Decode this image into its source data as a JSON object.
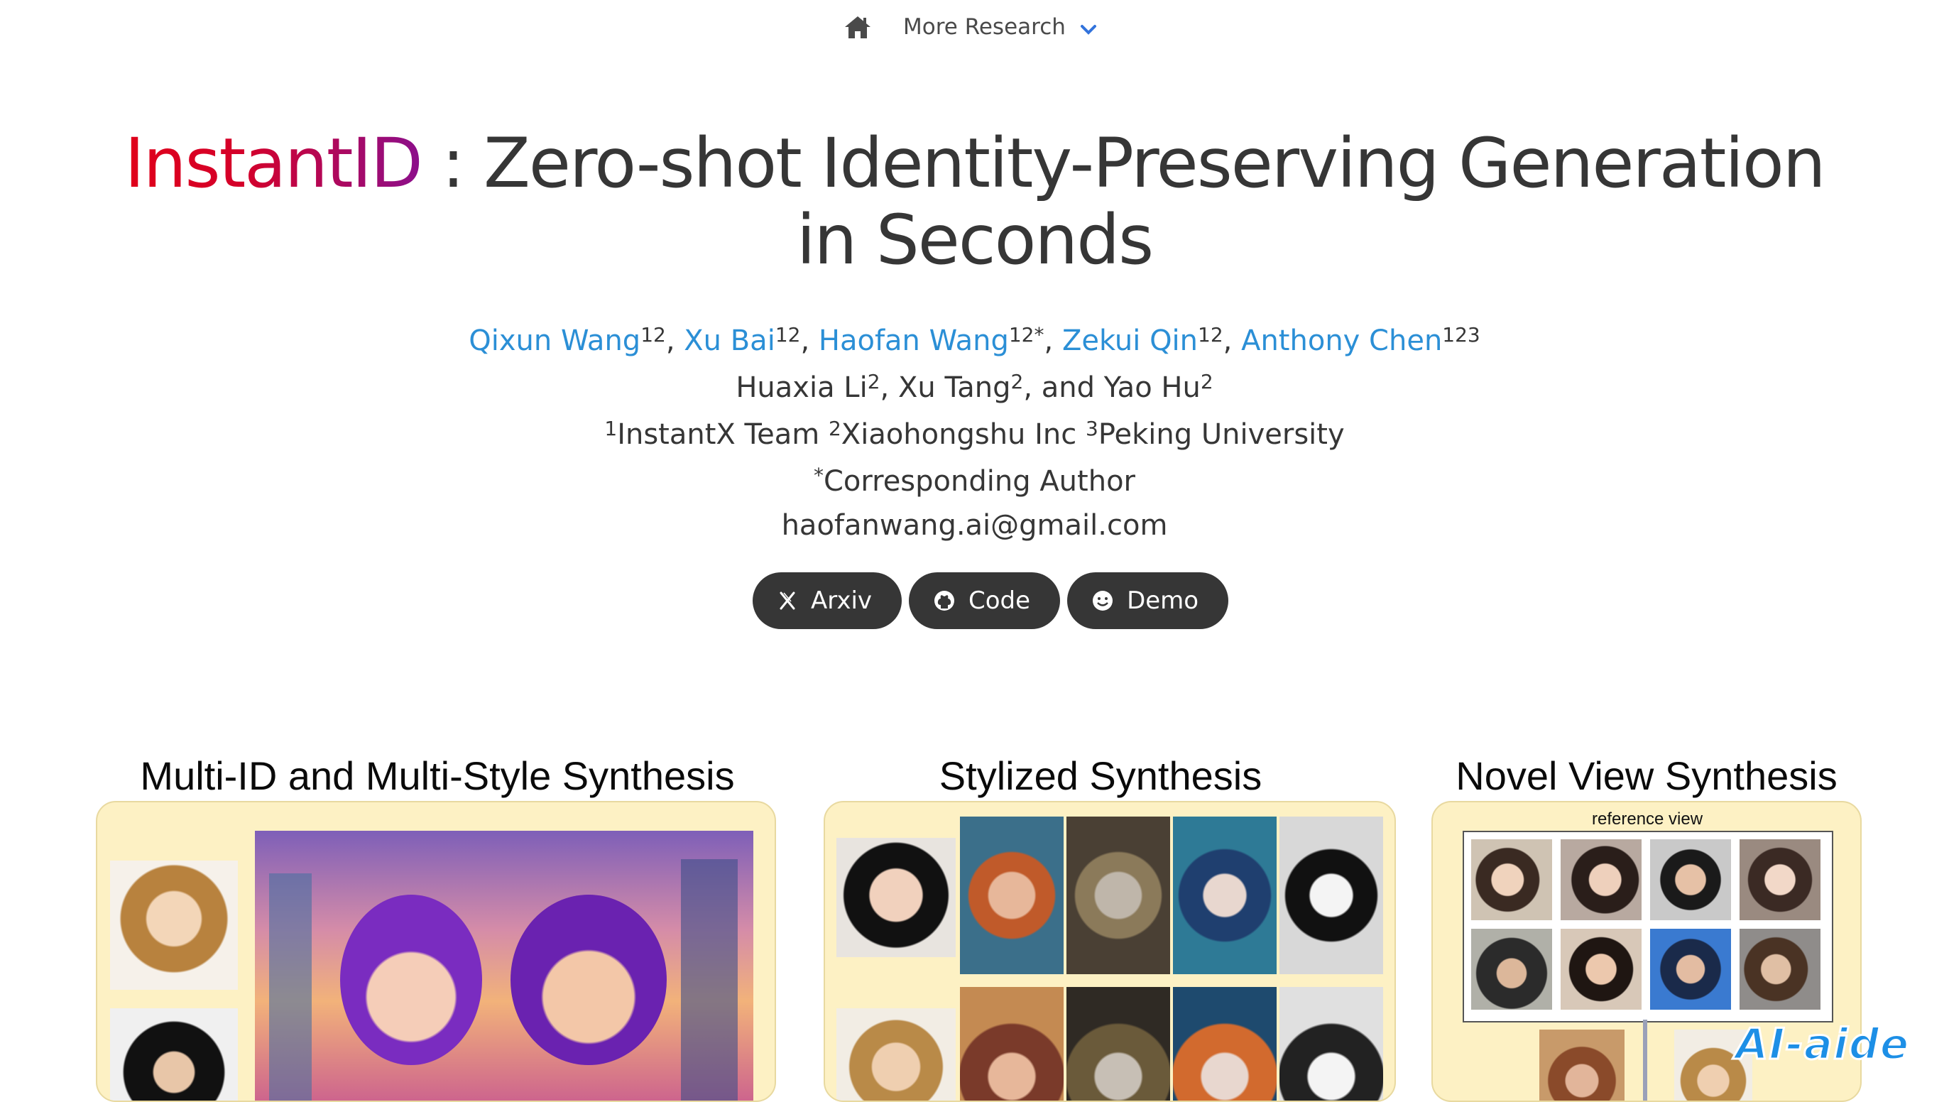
{
  "nav": {
    "home_icon": "home-icon",
    "more_label": "More Research",
    "chevron_icon": "chevron-down-icon"
  },
  "title": {
    "brand": "InstantID",
    "line1_rest": " : Zero-shot Identity-Preserving Generation",
    "line2": "in Seconds"
  },
  "authors": {
    "a1": "Qixun Wang",
    "a1_sup": "12",
    "a2": "Xu Bai",
    "a2_sup": "12",
    "a3": "Haofan Wang",
    "a3_sup": "12*",
    "a4": "Zekui Qin",
    "a4_sup": "12",
    "a5": "Anthony Chen",
    "a5_sup": "123",
    "b1": "Huaxia Li",
    "b1_sup": "2",
    "b2": "Xu Tang",
    "b2_sup": "2",
    "b3": "Yao Hu",
    "b3_sup": "2",
    "aff1_sup": "1",
    "aff1": "InstantX Team",
    "aff2_sup": "2",
    "aff2": "Xiaohongshu Inc",
    "aff3_sup": "3",
    "aff3": "Peking University",
    "corr_sup": "*",
    "corr": "Corresponding Author",
    "email": "haofanwang.ai@gmail.com"
  },
  "buttons": {
    "arxiv": "Arxiv",
    "code": "Code",
    "demo": "Demo"
  },
  "sections": {
    "multi": "Multi-ID and Multi-Style Synthesis",
    "stylized": "Stylized Synthesis",
    "novel": "Novel View Synthesis",
    "reference_view": "reference view"
  },
  "watermark": "AI-aide",
  "colors": {
    "link": "#2b8fd6",
    "button_bg": "#363636",
    "panel_bg": "#fdf1c4",
    "brand_start": "#e0001a",
    "brand_end": "#8b0f8c"
  }
}
